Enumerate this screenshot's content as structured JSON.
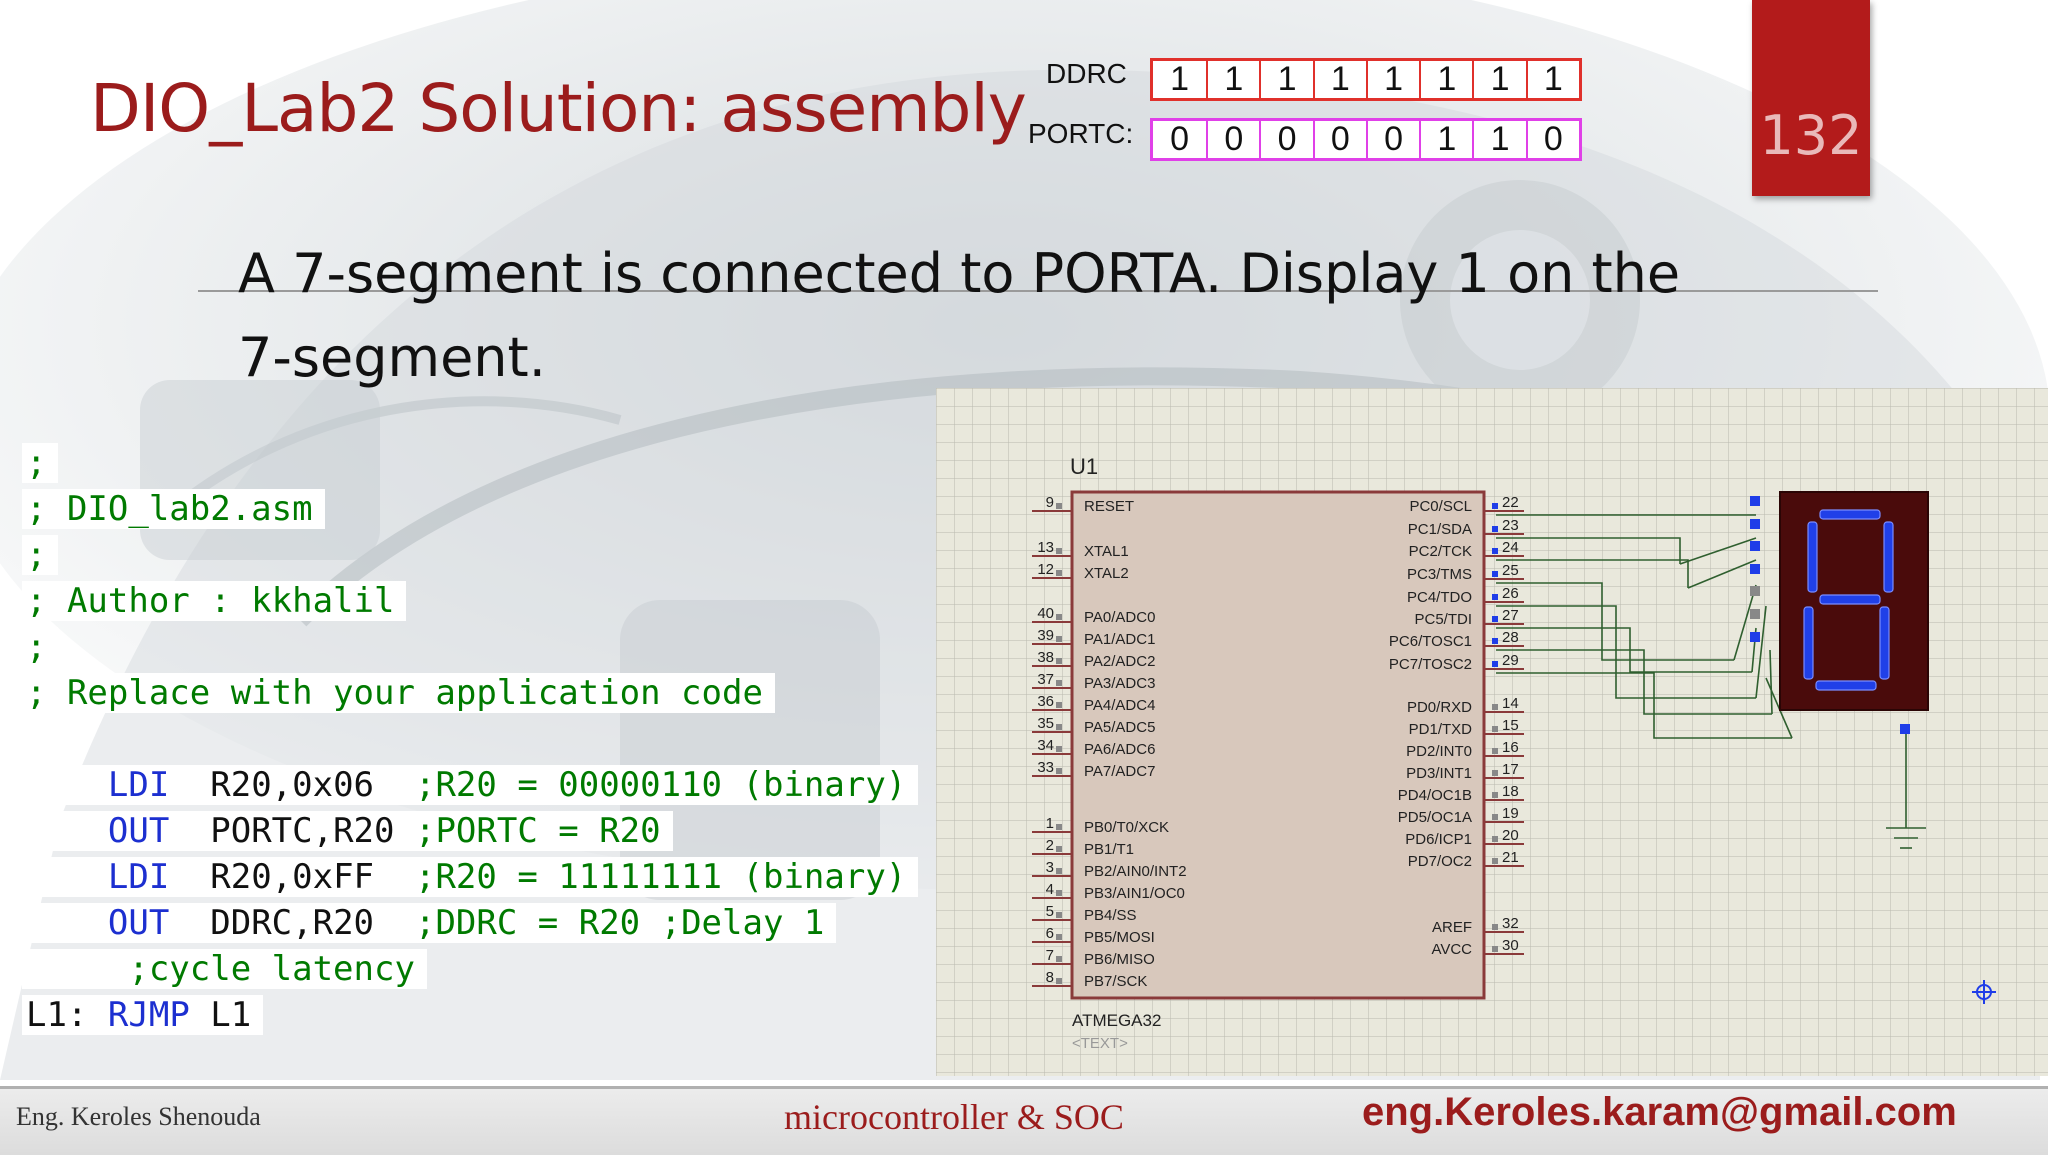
{
  "slide": {
    "title": "DIO_Lab2 Solution: assembly",
    "page_number": "132",
    "problem_line1": "A 7-segment is connected to PORTA. Display 1 on the",
    "problem_line2": "7-segment."
  },
  "registers": {
    "ddrc_label": "DDRC",
    "ddrc_bits": [
      "1",
      "1",
      "1",
      "1",
      "1",
      "1",
      "1",
      "1"
    ],
    "portc_label": "PORTC:",
    "portc_bits": [
      "0",
      "0",
      "0",
      "0",
      "0",
      "1",
      "1",
      "0"
    ]
  },
  "code": {
    "l1": ";",
    "l2": "; DIO_lab2.asm",
    "l3": ";",
    "l4": "; Author : kkhalil",
    "l5": ";",
    "l6": "; Replace with your application code",
    "i1_op": "LDI",
    "i1_args": "R20,0x06",
    "i1_comment": ";R20 = 00000110 (binary)",
    "i2_op": "OUT",
    "i2_args": "PORTC,R20",
    "i2_comment": ";PORTC = R20",
    "i3_op": "LDI",
    "i3_args": "R20,0xFF",
    "i3_comment": ";R20 = 11111111 (binary)",
    "i4_op": "OUT",
    "i4_args": "DDRC,R20",
    "i4_comment": ";DDRC = R20 ;Delay 1",
    "i4_comment2": ";cycle latency",
    "l_label": "L1:",
    "l_op": "RJMP",
    "l_arg": "L1"
  },
  "schematic": {
    "ref": "U1",
    "part": "ATMEGA32",
    "text_placeholder": "<TEXT>",
    "left_pins": [
      {
        "num": "9",
        "name": "RESET"
      },
      {
        "num": "13",
        "name": "XTAL1"
      },
      {
        "num": "12",
        "name": "XTAL2"
      },
      {
        "num": "40",
        "name": "PA0/ADC0"
      },
      {
        "num": "39",
        "name": "PA1/ADC1"
      },
      {
        "num": "38",
        "name": "PA2/ADC2"
      },
      {
        "num": "37",
        "name": "PA3/ADC3"
      },
      {
        "num": "36",
        "name": "PA4/ADC4"
      },
      {
        "num": "35",
        "name": "PA5/ADC5"
      },
      {
        "num": "34",
        "name": "PA6/ADC6"
      },
      {
        "num": "33",
        "name": "PA7/ADC7"
      },
      {
        "num": "1",
        "name": "PB0/T0/XCK"
      },
      {
        "num": "2",
        "name": "PB1/T1"
      },
      {
        "num": "3",
        "name": "PB2/AIN0/INT2"
      },
      {
        "num": "4",
        "name": "PB3/AIN1/OC0"
      },
      {
        "num": "5",
        "name": "PB4/SS"
      },
      {
        "num": "6",
        "name": "PB5/MOSI"
      },
      {
        "num": "7",
        "name": "PB6/MISO"
      },
      {
        "num": "8",
        "name": "PB7/SCK"
      }
    ],
    "right_pins": [
      {
        "num": "22",
        "name": "PC0/SCL"
      },
      {
        "num": "23",
        "name": "PC1/SDA"
      },
      {
        "num": "24",
        "name": "PC2/TCK"
      },
      {
        "num": "25",
        "name": "PC3/TMS"
      },
      {
        "num": "26",
        "name": "PC4/TDO"
      },
      {
        "num": "27",
        "name": "PC5/TDI"
      },
      {
        "num": "28",
        "name": "PC6/TOSC1"
      },
      {
        "num": "29",
        "name": "PC7/TOSC2"
      },
      {
        "num": "14",
        "name": "PD0/RXD"
      },
      {
        "num": "15",
        "name": "PD1/TXD"
      },
      {
        "num": "16",
        "name": "PD2/INT0"
      },
      {
        "num": "17",
        "name": "PD3/INT1"
      },
      {
        "num": "18",
        "name": "PD4/OC1B"
      },
      {
        "num": "19",
        "name": "PD5/OC1A"
      },
      {
        "num": "20",
        "name": "PD6/ICP1"
      },
      {
        "num": "21",
        "name": "PD7/OC2"
      },
      {
        "num": "32",
        "name": "AREF"
      },
      {
        "num": "30",
        "name": "AVCC"
      }
    ],
    "display_digit": "8"
  },
  "footer": {
    "author": "Eng. Keroles Shenouda",
    "course": "microcontroller & SOC",
    "email": "eng.Keroles.karam@gmail.com"
  },
  "colors": {
    "title_red": "#9b1c1c",
    "badge_red": "#b31b1b",
    "code_green": "#007a00",
    "code_blue": "#1c2fd0",
    "ddrc_border": "#e0302b",
    "portc_border": "#e040e8",
    "chip_fill": "#d8c8bc",
    "seg_blue": "#2040e8"
  }
}
